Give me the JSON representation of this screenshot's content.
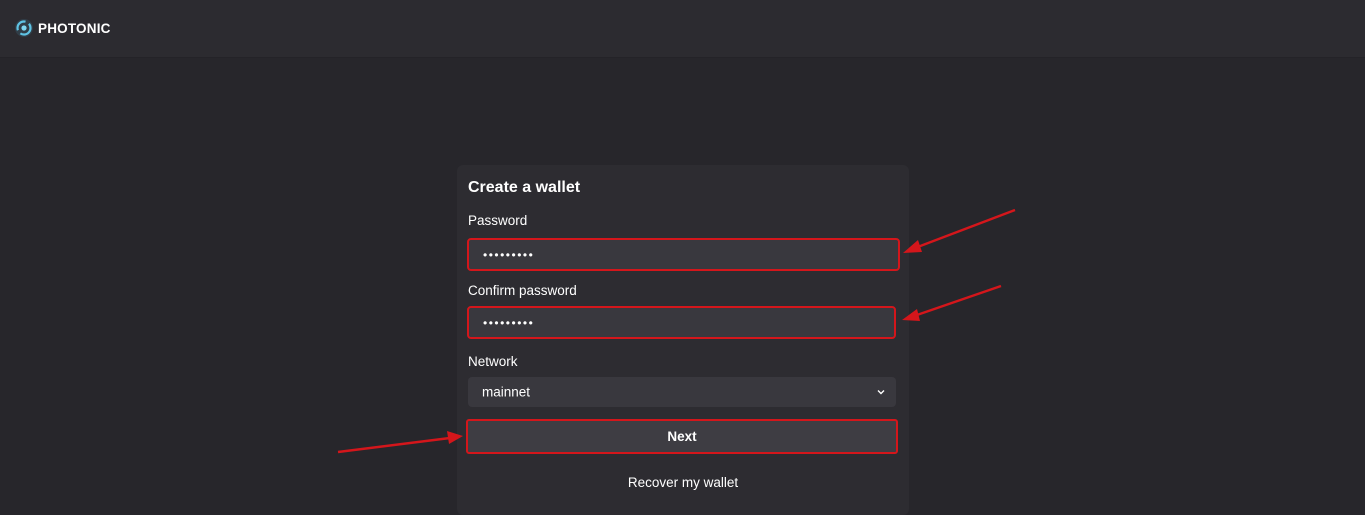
{
  "app": {
    "brand_name": "PHOTONIC"
  },
  "form": {
    "title": "Create a wallet",
    "password_label": "Password",
    "password_value": "•••••••••",
    "confirm_label": "Confirm password",
    "confirm_value": "•••••••••",
    "network_label": "Network",
    "network_selected": "mainnet",
    "next_label": "Next",
    "recover_label": "Recover my wallet"
  },
  "colors": {
    "background": "#27262b",
    "card": "#2d2c31",
    "field": "#39383e",
    "annotation_red": "#d4161b"
  },
  "icons": {
    "logo": "photonic-logo-icon",
    "select_chevron": "chevron-down-icon"
  }
}
